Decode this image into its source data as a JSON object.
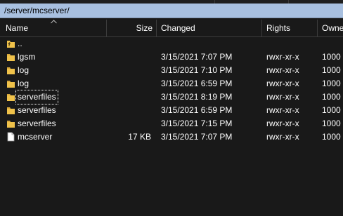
{
  "path": "/server/mcserver/",
  "columns": {
    "name": "Name",
    "size": "Size",
    "changed": "Changed",
    "rights": "Rights",
    "owner": "Owne"
  },
  "parent_label": "..",
  "rows": [
    {
      "name": "lgsm",
      "size": "",
      "changed": "3/15/2021 7:07 PM",
      "rights": "rwxr-xr-x",
      "owner": "1000",
      "icon": "folder-icon"
    },
    {
      "name": "log",
      "size": "",
      "changed": "3/15/2021 7:10 PM",
      "rights": "rwxr-xr-x",
      "owner": "1000",
      "icon": "folder-icon"
    },
    {
      "name": "log",
      "size": "",
      "changed": "3/15/2021 6:59 PM",
      "rights": "rwxr-xr-x",
      "owner": "1000",
      "icon": "folder-icon"
    },
    {
      "name": "serverfiles",
      "size": "",
      "changed": "3/15/2021 8:19 PM",
      "rights": "rwxr-xr-x",
      "owner": "1000",
      "icon": "folder-icon"
    },
    {
      "name": "serverfiles",
      "size": "",
      "changed": "3/15/2021 6:59 PM",
      "rights": "rwxr-xr-x",
      "owner": "1000",
      "icon": "folder-icon"
    },
    {
      "name": "serverfiles",
      "size": "",
      "changed": "3/15/2021 7:15 PM",
      "rights": "rwxr-xr-x",
      "owner": "1000",
      "icon": "folder-icon"
    },
    {
      "name": "mcserver",
      "size": "17 KB",
      "changed": "3/15/2021 7:07 PM",
      "rights": "rwxr-xr-x",
      "owner": "1000",
      "icon": "file-icon"
    }
  ],
  "colors": {
    "background": "#191919",
    "path_bar": "#a8c0e0",
    "folder": "#f0c24a",
    "text": "#ffffff"
  }
}
